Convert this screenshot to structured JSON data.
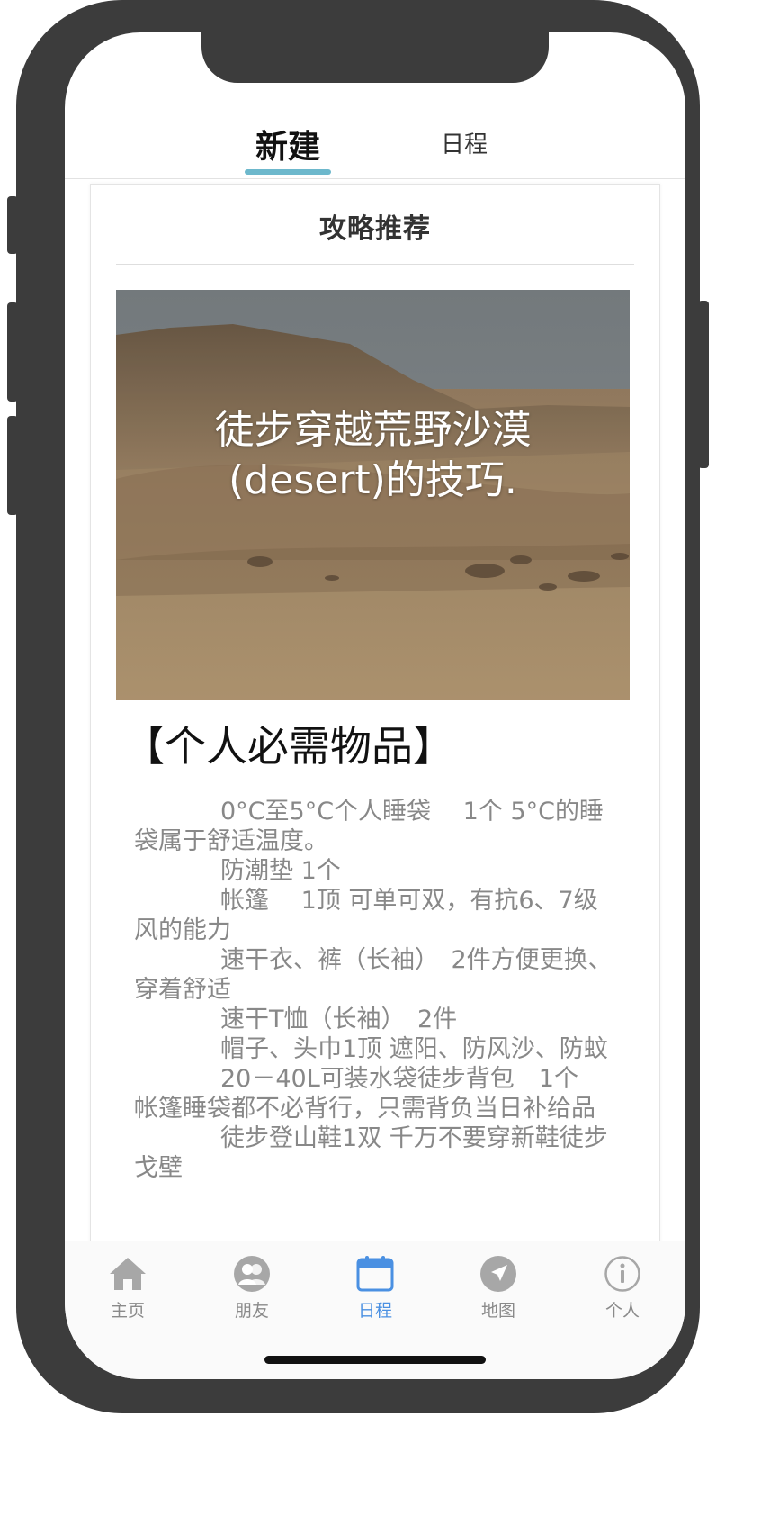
{
  "tabs": {
    "new_label": "新建",
    "schedule_label": "日程"
  },
  "card": {
    "title": "攻略推荐",
    "hero_title_line1": "徒步穿越荒野沙漠",
    "hero_title_line2": "(desert)的技巧.",
    "section_heading": "【个人必需物品】",
    "items": [
      {
        "first": "0°C至5°C个人睡袋　 1个 5°C",
        "rest": "的睡袋属于舒适温度。"
      },
      {
        "first": "防潮垫  1个",
        "rest": ""
      },
      {
        "first": "帐篷　 1顶 可单可双，有抗6、",
        "rest": "7级风的能力"
      },
      {
        "first": "速干衣、裤（长袖）　2件方便",
        "rest": "更换、穿着舒适"
      },
      {
        "first": "速干T恤（长袖）　2件",
        "rest": ""
      },
      {
        "first": "帽子、头巾1顶 遮阳、防风沙、",
        "rest": "防蚊"
      },
      {
        "first": "20－40L可装水袋徒步背包　1",
        "rest": "个　帐篷睡袋都不必背行，只需背负当日补给品"
      },
      {
        "first": "徒步登山鞋1双 千万不要穿新鞋",
        "rest": "徒步戈壁"
      }
    ]
  },
  "tabbar": {
    "items": [
      {
        "label": "主页",
        "icon": "home-icon"
      },
      {
        "label": "朋友",
        "icon": "friends-icon"
      },
      {
        "label": "日程",
        "icon": "calendar-icon"
      },
      {
        "label": "地图",
        "icon": "map-icon"
      },
      {
        "label": "个人",
        "icon": "info-icon"
      }
    ],
    "active_index": 2,
    "active_color": "#4a90e2",
    "inactive_color": "#a7a7a7"
  },
  "colors": {
    "tab_indicator": "#6db8cc",
    "phone_frame": "#3c3c3c"
  }
}
